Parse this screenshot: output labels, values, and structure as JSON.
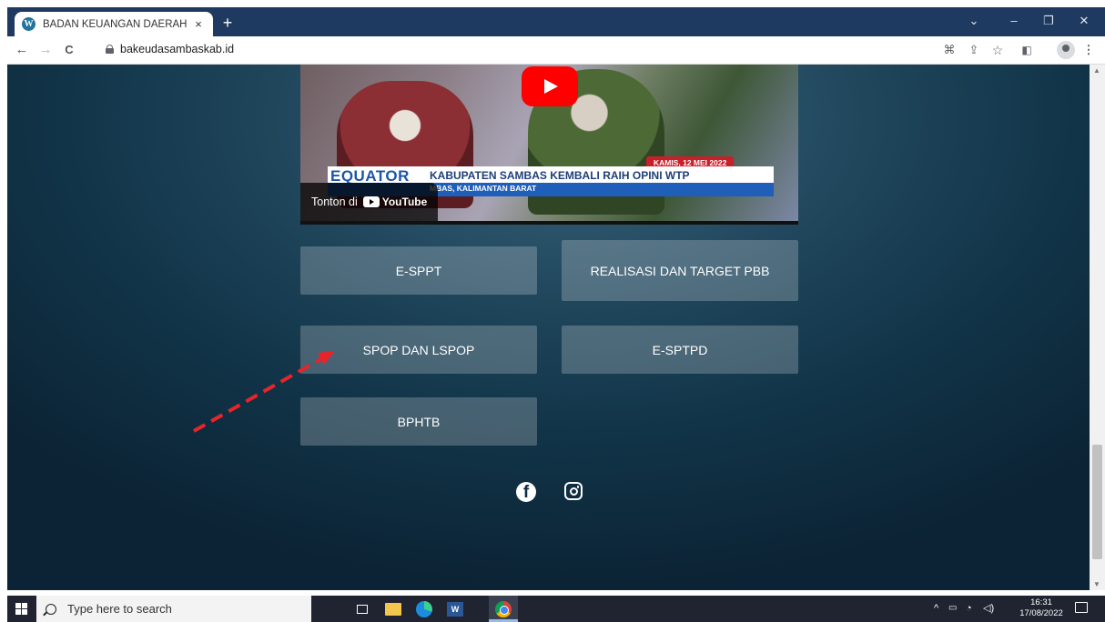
{
  "browser": {
    "tab_title": "BADAN KEUANGAN DAERAH",
    "tab_close": "×",
    "new_tab": "+",
    "url": "bakeudasambaskab.id",
    "window_controls": {
      "dropdown": "⌄",
      "minimize": "–",
      "maximize": "❐",
      "close": "✕"
    },
    "nav": {
      "back": "←",
      "forward": "→",
      "reload": "C"
    },
    "toolbar_icons": [
      "translate-icon",
      "share-icon",
      "star-icon",
      "side-panel-icon",
      "profile-icon",
      "menu-icon"
    ]
  },
  "video": {
    "date_badge": "KAMIS, 12 MEI 2022",
    "brand": "EQUATOR",
    "headline": "KABUPATEN SAMBAS KEMBALI RAIH OPINI WTP",
    "subline": "MBAS, KALIMANTAN BARAT",
    "watch_on": "Tonton di",
    "youtube_label": "YouTube"
  },
  "links": {
    "espt": "E-SPPT",
    "realisasi": "REALISASI DAN TARGET PBB",
    "spop": "SPOP DAN LSPOP",
    "esptpd": "E-SPTPD",
    "bphtb": "BPHTB"
  },
  "social": {
    "facebook": "f"
  },
  "taskbar": {
    "search_placeholder": "Type here to search",
    "apps": [
      "task-view-icon",
      "file-explorer-icon",
      "edge-icon",
      "word-icon",
      "chrome-icon"
    ],
    "tray_chevron": "^",
    "time": "16:31",
    "date": "17/08/2022"
  },
  "colors": {
    "tabbar": "#1f3a60",
    "page_bg": "#1c4258",
    "button_bg": "rgba(255,255,255,0.22)",
    "annotation_arrow": "#e8242b"
  }
}
